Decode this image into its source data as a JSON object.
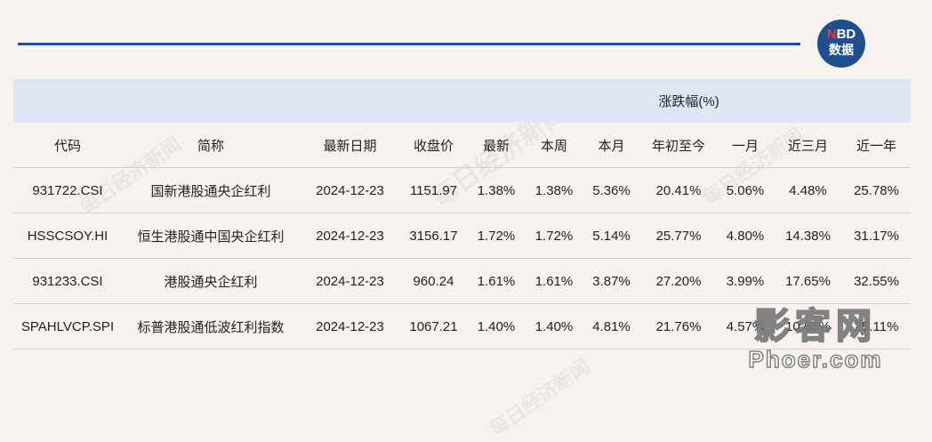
{
  "logo": {
    "line1_prefix": "N",
    "line1_rest": "BD",
    "line2": "数据"
  },
  "table": {
    "group_header": "涨跌幅(%)",
    "columns": [
      "代码",
      "简称",
      "最新日期",
      "收盘价",
      "最新",
      "本周",
      "本月",
      "年初至今",
      "一月",
      "近三月",
      "近一年"
    ],
    "rows": [
      [
        "931722.CSI",
        "国新港股通央企红利",
        "2024-12-23",
        "1151.97",
        "1.38%",
        "1.38%",
        "5.36%",
        "20.41%",
        "5.06%",
        "4.48%",
        "25.78%"
      ],
      [
        "HSSCSOY.HI",
        "恒生港股通中国央企红利",
        "2024-12-23",
        "3156.17",
        "1.72%",
        "1.72%",
        "5.14%",
        "25.77%",
        "4.80%",
        "14.38%",
        "31.17%"
      ],
      [
        "931233.CSI",
        "港股通央企红利",
        "2024-12-23",
        "960.24",
        "1.61%",
        "1.61%",
        "3.87%",
        "27.20%",
        "3.99%",
        "17.65%",
        "32.55%"
      ],
      [
        "SPAHLVCP.SPI",
        "标普港股通低波红利指数",
        "2024-12-23",
        "1067.21",
        "1.40%",
        "1.40%",
        "4.81%",
        "21.76%",
        "4.57%",
        "10.65%",
        "25.11%"
      ]
    ]
  },
  "watermarks": {
    "text": "每日经济新闻",
    "site_cn": "影客网",
    "site_en": "Phoer.com"
  },
  "colors": {
    "background": "#f6f3ee",
    "header_band": "#dce7f3",
    "accent_blue": "#1f4f8f",
    "logo_red": "#e53935"
  }
}
